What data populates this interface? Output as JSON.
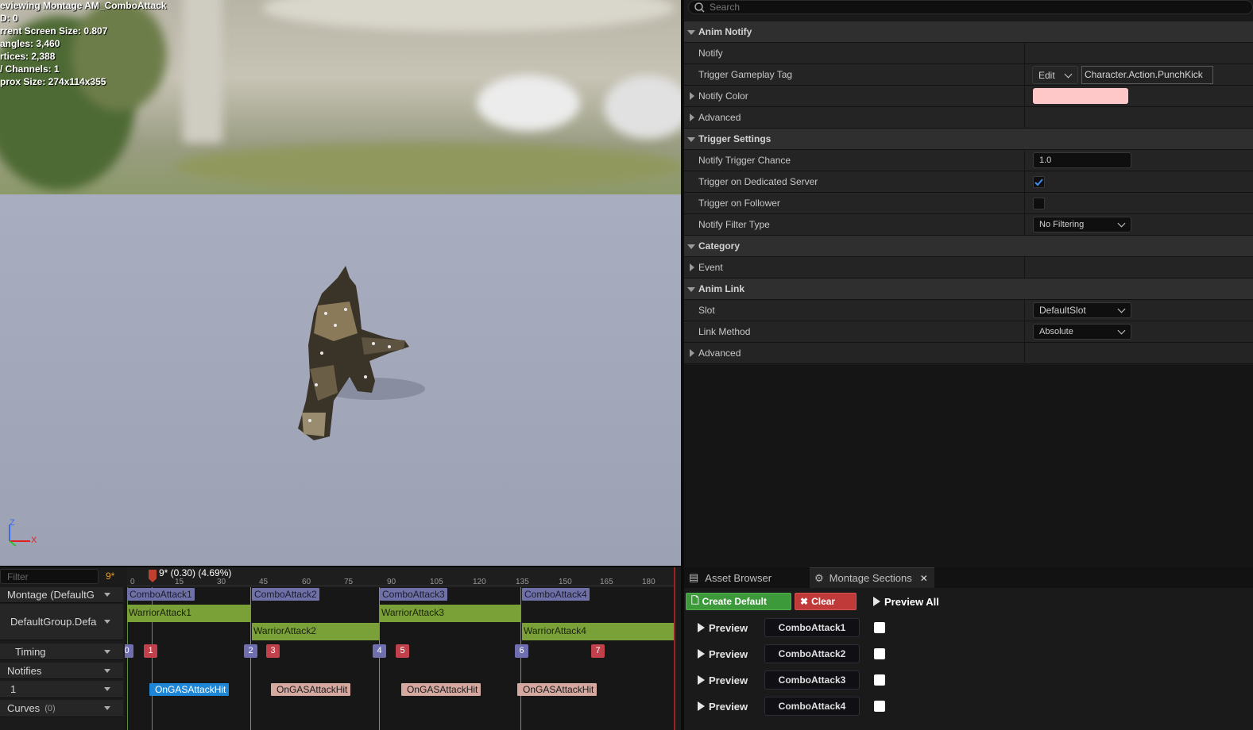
{
  "viewport": {
    "stats": [
      "eviewing Montage AM_ComboAttack",
      "D: 0",
      "rrent Screen Size: 0.807",
      "angles: 3,460",
      "rtices: 2,388",
      "/ Channels: 1",
      "prox Size: 274x114x355"
    ],
    "axis_labels": {
      "z": "Z",
      "x": "X",
      "y": "Y"
    }
  },
  "details": {
    "search_placeholder": "Search",
    "categories": [
      {
        "label": "Anim Notify"
      },
      {
        "label": "Trigger Settings"
      },
      {
        "label": "Category"
      },
      {
        "label": "Anim Link"
      }
    ],
    "props": {
      "notify": "Notify",
      "trigger_tag": "Trigger Gameplay Tag",
      "edit_label": "Edit",
      "tag_value": "Character.Action.PunchKick",
      "notify_color": "Notify Color",
      "notify_color_value": "#ffc8c8",
      "advanced1": "Advanced",
      "trigger_chance": "Notify Trigger Chance",
      "trigger_chance_value": "1.0",
      "dedicated_server": "Trigger on Dedicated Server",
      "dedicated_server_checked": true,
      "follower": "Trigger on Follower",
      "follower_checked": false,
      "filter_type": "Notify Filter Type",
      "filter_type_value": "No Filtering",
      "event": "Event",
      "slot": "Slot",
      "slot_value": "DefaultSlot",
      "link_method": "Link Method",
      "link_method_value": "Absolute",
      "advanced2": "Advanced"
    }
  },
  "timeline": {
    "filter_placeholder": "Filter",
    "frame_count": "9*",
    "scrubber_label": "9* (0.30) (4.69%)",
    "ticks": [
      "0",
      "15",
      "30",
      "45",
      "60",
      "75",
      "90",
      "105",
      "120",
      "135",
      "150",
      "165",
      "180"
    ],
    "tracks": {
      "montage": "Montage (DefaultG",
      "group": "DefaultGroup.Defa",
      "timing": "Timing",
      "notifies": "Notifies",
      "notify_track": "1",
      "curves": "Curves",
      "curves_count": "(0)"
    },
    "sections": [
      "ComboAttack1",
      "ComboAttack2",
      "ComboAttack3",
      "ComboAttack4"
    ],
    "segments": [
      "WarriorAttack1",
      "WarriorAttack2",
      "WarriorAttack3",
      "WarriorAttack4"
    ],
    "timing_markers": [
      "0",
      "1",
      "2",
      "3",
      "4",
      "5",
      "6",
      "7"
    ],
    "notifies": [
      "OnGASAttackHit",
      "OnGASAttackHit",
      "OnGASAttackHit",
      "OnGASAttackHit"
    ]
  },
  "montage_sections": {
    "tabs": {
      "asset_browser": "Asset Browser",
      "montage_sections": "Montage Sections"
    },
    "create_default": "Create Default",
    "clear": "Clear",
    "preview_all": "Preview All",
    "preview_label": "Preview",
    "rows": [
      "ComboAttack1",
      "ComboAttack2",
      "ComboAttack3",
      "ComboAttack4"
    ]
  },
  "colors": {
    "accent_green": "#3d9a3a",
    "clear_red": "#c03a3a",
    "section_purple": "#7070a8",
    "segment_green": "#7aa038",
    "notify_pink": "#d5a8a0",
    "selected_notify_blue": "#1e86d6"
  }
}
